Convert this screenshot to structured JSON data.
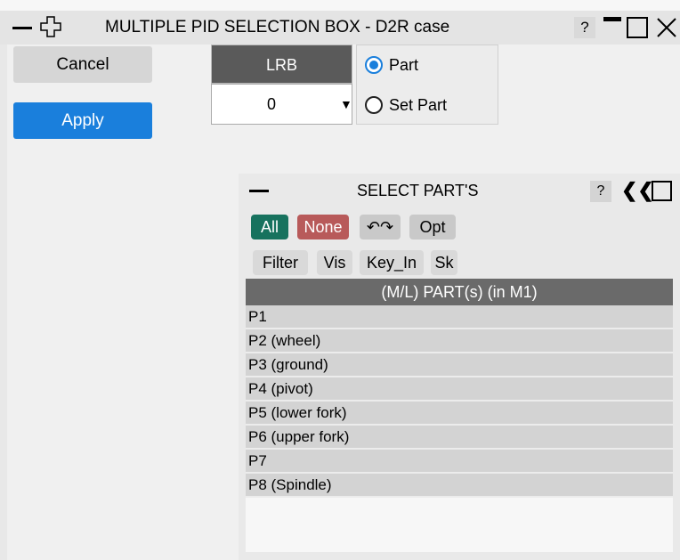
{
  "window": {
    "title": "MULTIPLE PID SELECTION BOX - D2R case",
    "help_label": "?"
  },
  "actions": {
    "cancel_label": "Cancel",
    "apply_label": "Apply",
    "apply_color": "#1a7fdc"
  },
  "lrb": {
    "header": "LRB",
    "value": "0",
    "dropdown_glyph": "▼"
  },
  "type_radio": {
    "options": [
      "Part",
      "Set Part"
    ],
    "selected": "Part"
  },
  "select_parts": {
    "title": "SELECT PART'S",
    "help_label": "?",
    "collapse_glyph": "❮❮",
    "buttons_row1": {
      "all": "All",
      "none": "None",
      "swap": "↶↷",
      "opt": "Opt"
    },
    "buttons_row2": {
      "filter": "Filter",
      "vis": "Vis",
      "key_in": "Key_In",
      "sk": "Sk"
    },
    "list_header": "(M/L) PART(s) (in M1)",
    "items": [
      "P1",
      "P2 (wheel)",
      "P3 (ground)",
      "P4 (pivot)",
      "P5 (lower fork)",
      "P6 (upper fork)",
      "P7",
      "P8 (Spindle)"
    ],
    "colors": {
      "all": "#17725e",
      "none": "#b85a5a"
    }
  }
}
